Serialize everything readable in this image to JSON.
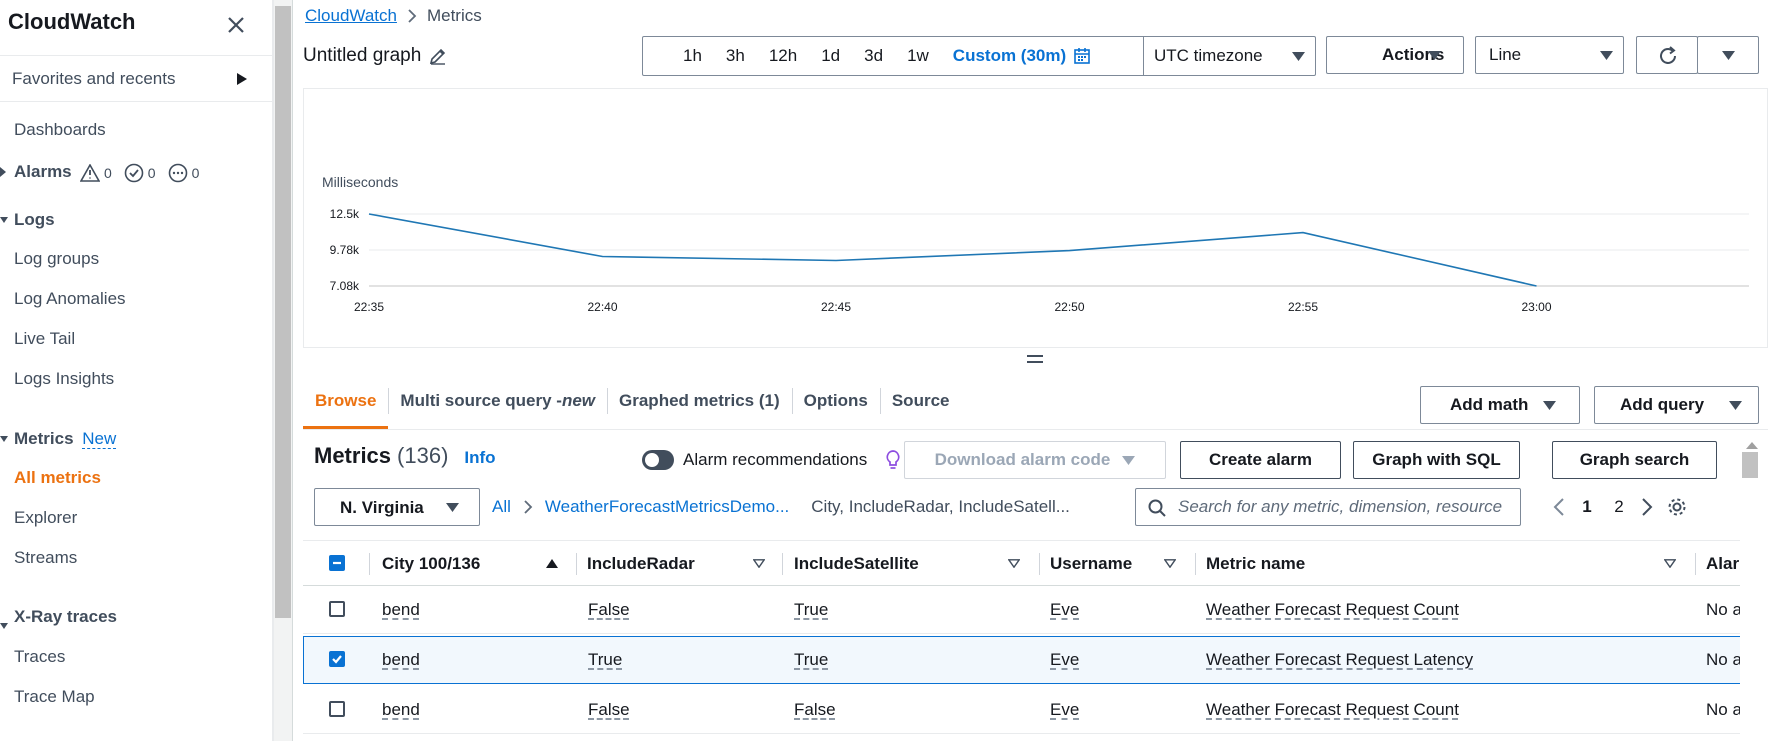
{
  "sidebar": {
    "title": "CloudWatch",
    "favorites_label": "Favorites and recents",
    "dashboards": "Dashboards",
    "alarms": {
      "label": "Alarms",
      "in_alarm": "0",
      "ok": "0",
      "insufficient": "0"
    },
    "logs": {
      "label": "Logs",
      "items": [
        "Log groups",
        "Log Anomalies",
        "Live Tail",
        "Logs Insights"
      ]
    },
    "metrics": {
      "label": "Metrics",
      "badge": "New",
      "items": [
        "All metrics",
        "Explorer",
        "Streams"
      ]
    },
    "xray": {
      "label": "X-Ray traces",
      "items": [
        "Traces",
        "Trace Map"
      ]
    }
  },
  "breadcrumb": {
    "root": "CloudWatch",
    "current": "Metrics"
  },
  "graph": {
    "title": "Untitled graph"
  },
  "time_range": {
    "options": [
      "1h",
      "3h",
      "12h",
      "1d",
      "3d",
      "1w"
    ],
    "custom": "Custom (30m)",
    "timezone": "UTC timezone"
  },
  "toolbar": {
    "actions": "Actions",
    "chart_type": "Line"
  },
  "chart_data": {
    "type": "line",
    "ylabel": "Milliseconds",
    "x": [
      "22:35",
      "22:40",
      "22:45",
      "22:50",
      "22:55",
      "23:00"
    ],
    "y_ticks": [
      "12.5k",
      "9.78k",
      "7.08k"
    ],
    "ylim": [
      7080,
      12500
    ],
    "series": [
      {
        "values": [
          12500,
          9300,
          9000,
          9750,
          11100,
          7080
        ],
        "color": "#1f77b4"
      }
    ]
  },
  "tabs": [
    {
      "label": "Browse",
      "active": true
    },
    {
      "label": "Multi source query - ",
      "suffix": "new"
    },
    {
      "label": "Graphed metrics (1)"
    },
    {
      "label": "Options"
    },
    {
      "label": "Source"
    }
  ],
  "panel_buttons": {
    "add_math": "Add math",
    "add_query": "Add query"
  },
  "metrics_panel": {
    "title": "Metrics",
    "count": "(136)",
    "info": "Info",
    "alarm_recommendations": "Alarm recommendations",
    "download_alarm_code": "Download alarm code",
    "create_alarm": "Create alarm",
    "graph_with_sql": "Graph with SQL",
    "graph_search": "Graph search",
    "region": "N. Virginia",
    "crumbs": {
      "all": "All",
      "namespace": "WeatherForecastMetricsDemo...",
      "dimensions": "City, IncludeRadar, IncludeSatell..."
    },
    "search_placeholder": "Search for any metric, dimension, resource",
    "pages": [
      "1",
      "2"
    ],
    "current_page": "1"
  },
  "table": {
    "columns": [
      "City 100/136",
      "IncludeRadar",
      "IncludeSatellite",
      "Username",
      "Metric name",
      "Alar"
    ],
    "rows": [
      {
        "checked": false,
        "city": "bend",
        "radar": "False",
        "satellite": "True",
        "username": "Eve",
        "metric": "Weather Forecast Request Count",
        "alarm": "No a"
      },
      {
        "checked": true,
        "city": "bend",
        "radar": "True",
        "satellite": "True",
        "username": "Eve",
        "metric": "Weather Forecast Request Latency",
        "alarm": "No a"
      },
      {
        "checked": false,
        "city": "bend",
        "radar": "False",
        "satellite": "False",
        "username": "Eve",
        "metric": "Weather Forecast Request Count",
        "alarm": "No a"
      }
    ]
  },
  "colors": {
    "accent": "#ec7211",
    "link": "#0972d3",
    "line": "#1f77b4"
  }
}
